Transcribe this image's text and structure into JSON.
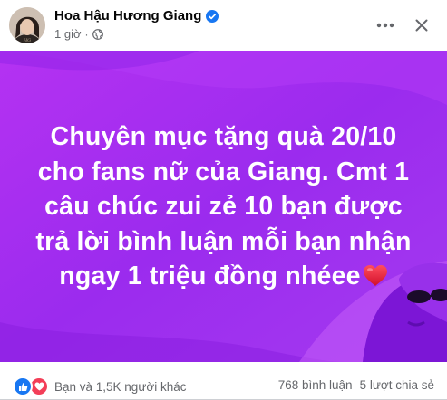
{
  "post": {
    "author_name": "Hoa Hậu Hương Giang",
    "time": "1 giờ",
    "separator": "·",
    "privacy_icon": "globe-icon",
    "verified_icon": "verified-badge-icon",
    "avatar_text": "HHG"
  },
  "content": {
    "line1": "Chuyên mục tặng quà 20/10",
    "line2": "cho fans nữ của Giang. Cmt 1",
    "line3": "câu chúc zui zẻ 10 bạn được",
    "line4": "trả lời bình luận mỗi bạn nhận",
    "line5": "ngay 1 triệu đồng nhéee",
    "background_color": "#a02cf0",
    "text_color": "#ffffff"
  },
  "footer": {
    "reactions_text": "Bạn và 1,5K người khác",
    "comments": "768 bình luận",
    "shares": "5 lượt chia sẻ",
    "reaction_icons": [
      "like-icon",
      "love-icon"
    ]
  },
  "colors": {
    "accent": "#1877f2",
    "love": "#f33e58",
    "secondary_text": "#65676b",
    "primary_text": "#050505"
  }
}
